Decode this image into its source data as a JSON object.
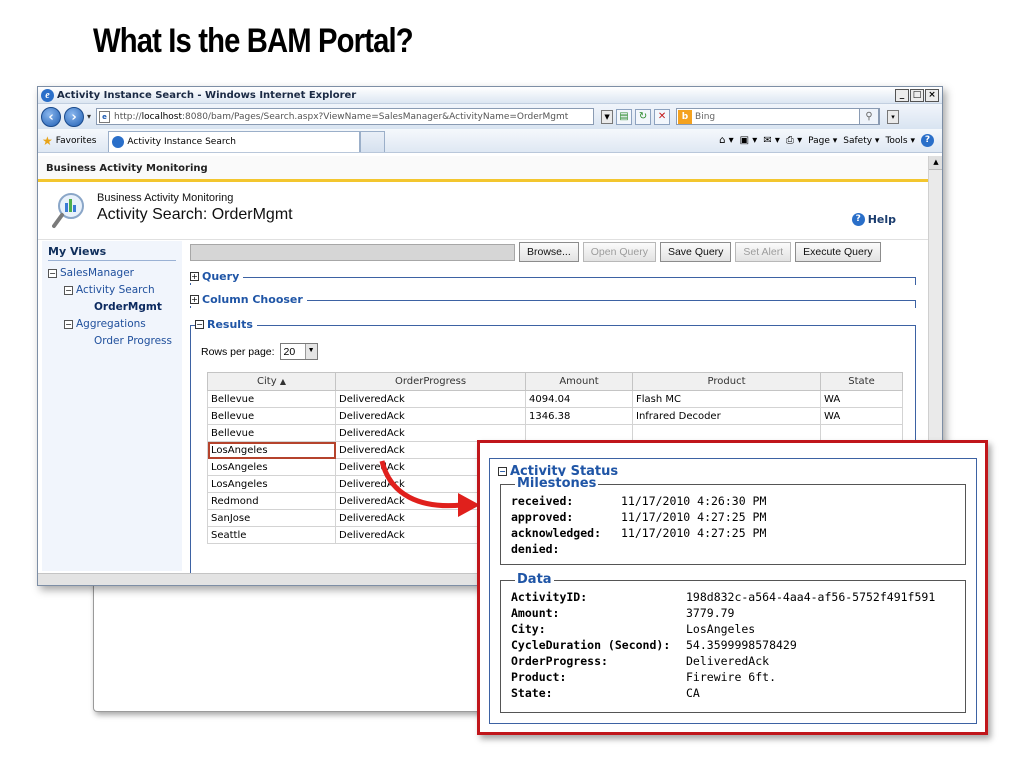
{
  "slide": {
    "title": "What Is the BAM Portal?"
  },
  "browser": {
    "window_title": "Activity Instance Search - Windows Internet Explorer",
    "controls": [
      "_",
      "□",
      "×"
    ],
    "url_prefix": "http://",
    "url_host": "localhost",
    "url_rest": ":8080/bam/Pages/Search.aspx?ViewName=SalesManager&ActivityName=OrderMgmt",
    "search_placeholder": "Bing",
    "favorites_label": "Favorites",
    "tab_label": "Activity Instance Search",
    "commands": [
      "Page ▾",
      "Safety ▾",
      "Tools ▾"
    ]
  },
  "portal": {
    "bar_title": "Business Activity Monitoring",
    "header_sub": "Business Activity Monitoring",
    "header_main": "Activity Search: OrderMgmt",
    "help": "Help"
  },
  "sidebar": {
    "title": "My Views",
    "items": [
      {
        "label": "SalesManager"
      },
      {
        "label": "Activity Search"
      },
      {
        "label": "OrderMgmt"
      },
      {
        "label": "Aggregations"
      },
      {
        "label": "Order Progress"
      }
    ]
  },
  "toolbar": {
    "browse": "Browse...",
    "open_query": "Open Query",
    "save_query": "Save Query",
    "set_alert": "Set Alert",
    "execute_query": "Execute Query"
  },
  "sections": {
    "query": "Query",
    "column_chooser": "Column Chooser",
    "results": "Results"
  },
  "results": {
    "rows_per_page_label": "Rows per page:",
    "rows_per_page_value": "20",
    "columns": [
      "City",
      "OrderProgress",
      "Amount",
      "Product",
      "State"
    ],
    "rows": [
      [
        "Bellevue",
        "DeliveredAck",
        "4094.04",
        "Flash MC",
        "WA"
      ],
      [
        "Bellevue",
        "DeliveredAck",
        "1346.38",
        "Infrared Decoder",
        "WA"
      ],
      [
        "Bellevue",
        "DeliveredAck",
        "",
        "",
        ""
      ],
      [
        "LosAngeles",
        "DeliveredAck",
        "",
        "",
        ""
      ],
      [
        "LosAngeles",
        "DeliveredAck",
        "",
        "",
        ""
      ],
      [
        "LosAngeles",
        "DeliveredAck",
        "",
        "",
        ""
      ],
      [
        "Redmond",
        "DeliveredAck",
        "",
        "",
        ""
      ],
      [
        "SanJose",
        "DeliveredAck",
        "",
        "",
        ""
      ],
      [
        "Seattle",
        "DeliveredAck",
        "",
        "",
        ""
      ]
    ]
  },
  "activity_status": {
    "title": "Activity Status",
    "milestones_title": "Milestones",
    "milestones": [
      {
        "key": "received:",
        "value": "11/17/2010 4:26:30 PM"
      },
      {
        "key": "approved:",
        "value": "11/17/2010 4:27:25 PM"
      },
      {
        "key": "acknowledged:",
        "value": "11/17/2010 4:27:25 PM"
      },
      {
        "key": "denied:",
        "value": ""
      }
    ],
    "data_title": "Data",
    "data": [
      {
        "key": "ActivityID:",
        "value": "198d832c-a564-4aa4-af56-5752f491f591"
      },
      {
        "key": "Amount:",
        "value": "3779.79"
      },
      {
        "key": "City:",
        "value": "LosAngeles"
      },
      {
        "key": "CycleDuration (Second):",
        "value": "54.3599998578429"
      },
      {
        "key": "OrderProgress:",
        "value": "DeliveredAck"
      },
      {
        "key": "Product:",
        "value": "Firewire 6ft."
      },
      {
        "key": "State:",
        "value": "CA"
      }
    ]
  },
  "colors": {
    "accent_blue": "#1f55a6",
    "highlight_red": "#c0161b",
    "bar_yellow": "#f3c62e"
  }
}
